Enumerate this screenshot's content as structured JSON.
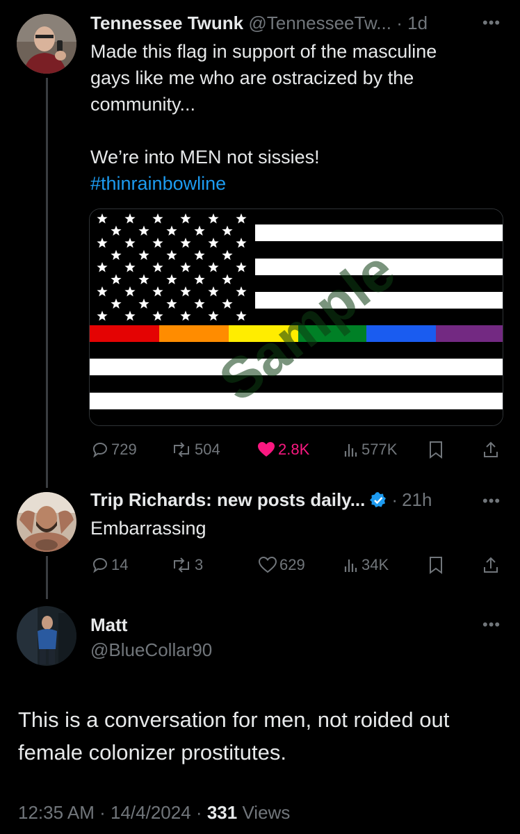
{
  "tweet1": {
    "display_name": "Tennessee Twunk",
    "handle": "@TennesseeTw...",
    "time": "1d",
    "text_line1": "Made this flag in support of the masculine",
    "text_line2": "gays like me who are ostracized by the",
    "text_line3": "community...",
    "text_line4": "We’re into MEN not sissies!",
    "hashtag": "#thinrainbowline",
    "watermark": "Sample",
    "replies": "729",
    "reposts": "504",
    "likes": "2.8K",
    "views": "577K"
  },
  "tweet2": {
    "display_name": "Trip Richards: new posts daily...",
    "time": "21h",
    "text": "Embarrassing",
    "replies": "14",
    "reposts": "3",
    "likes": "629",
    "views": "34K"
  },
  "tweet3": {
    "display_name": "Matt",
    "handle": "@BlueCollar90",
    "text_line1": "This is a conversation for men, not roided out",
    "text_line2": "female colonizer prostitutes.",
    "time": "12:35 AM",
    "date": "14/4/2024",
    "views_count": "331",
    "views_label": "Views"
  },
  "colors": {
    "background": "#000000",
    "text": "#e7e9ea",
    "muted": "#71767b",
    "link": "#1d9bf0",
    "like": "#f91880",
    "verified": "#1d9bf0"
  },
  "icons": [
    "reply-icon",
    "repost-icon",
    "like-icon",
    "views-icon",
    "bookmark-icon",
    "share-icon",
    "more-icon",
    "verified-badge-icon"
  ]
}
